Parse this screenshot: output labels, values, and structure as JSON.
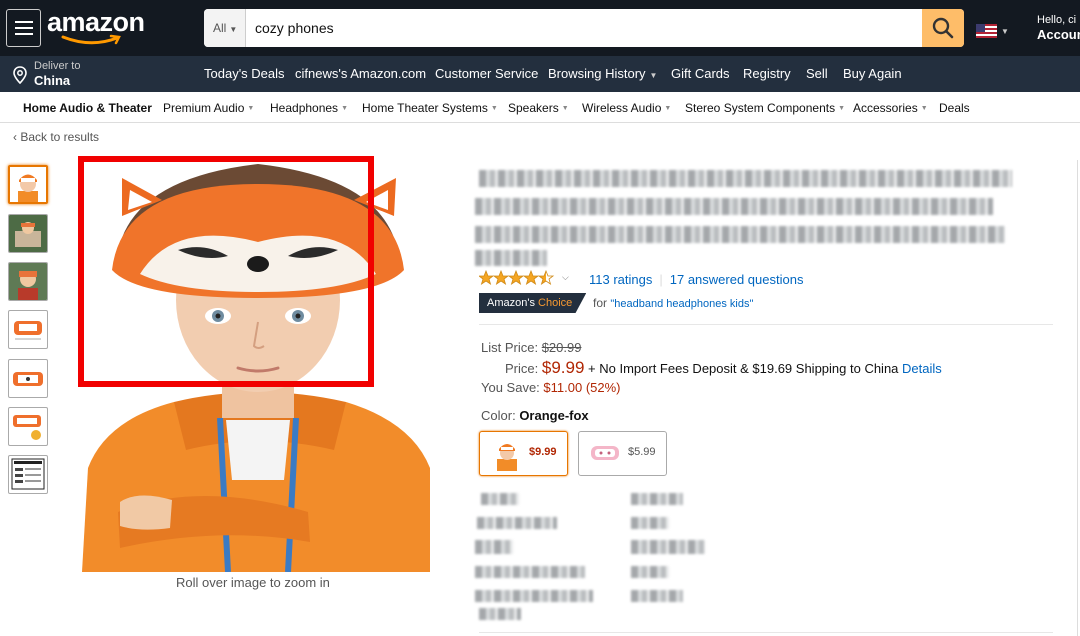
{
  "header": {
    "logo": "amazon",
    "search_category": "All",
    "search_query": "cozy phones",
    "greeting": "Hello, ci",
    "account_label": "Accoun"
  },
  "subnav": {
    "deliver_label": "Deliver to",
    "deliver_location": "China",
    "links": [
      "Today's Deals",
      "cifnews's Amazon.com",
      "Customer Service",
      "Browsing History",
      "Gift Cards",
      "Registry",
      "Sell",
      "Buy Again"
    ]
  },
  "categories": [
    "Home Audio & Theater",
    "Premium Audio",
    "Headphones",
    "Home Theater Systems",
    "Speakers",
    "Wireless Audio",
    "Stereo System Components",
    "Accessories",
    "Deals"
  ],
  "back_link": "‹ Back to results",
  "zoom_hint": "Roll over image to zoom in",
  "product": {
    "rating_stars": 4.5,
    "ratings_count": "113 ratings",
    "answered": "17 answered questions",
    "choice_prefix": "Amazon's",
    "choice_suffix": "Choice",
    "choice_for": "for",
    "choice_query": "\"headband headphones kids\"",
    "list_price_label": "List Price:",
    "list_price": "$20.99",
    "price_label": "Price:",
    "price": "$9.99",
    "shipping_text": "+ No Import Fees Deposit & $19.69 Shipping to China",
    "details_link": "Details",
    "save_label": "You Save:",
    "save_value": "$11.00 (52%)",
    "color_label": "Color:",
    "color_value": "Orange-fox",
    "variants": [
      {
        "price": "$9.99",
        "name": "orange-fox"
      },
      {
        "price": "$5.99",
        "name": "pink"
      }
    ]
  },
  "colors": {
    "accent_orange": "#febd69",
    "nav_dark": "#131921",
    "nav_mid": "#232f3e",
    "price_red": "#b12704",
    "link_blue": "#0066c0",
    "highlight_red": "#f10000"
  }
}
